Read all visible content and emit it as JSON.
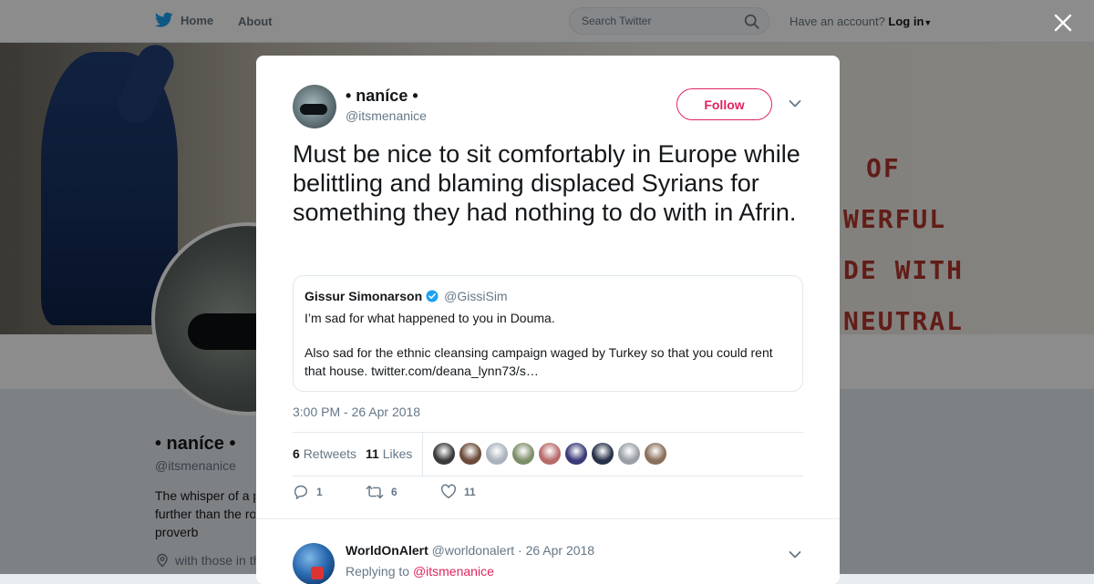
{
  "nav": {
    "home_label": "Home",
    "about_label": "About",
    "search_placeholder": "Search Twitter",
    "have_account_text": "Have an account?",
    "login_label": "Log in"
  },
  "background_profile": {
    "banner_text": [
      "OF",
      "WERFUL",
      "DE WITH",
      "NEUTRAL"
    ],
    "name": "• naníce •",
    "handle": "@itsmenanice",
    "bio": "The whisper of a p further than the ro proverb",
    "bio_lines": [
      "The whisper of a p",
      "further than the ro",
      "proverb"
    ],
    "location": "with those in th"
  },
  "tweet": {
    "author_name": "• naníce •",
    "author_handle": "@itsmenanice",
    "follow_label": "Follow",
    "text": "Must be nice to sit comfortably in Europe while belittling and blaming displaced Syrians for something they had nothing to do with in Afrin.",
    "quoted": {
      "author_name": "Gissur Simonarson",
      "author_handle": "@GissiSim",
      "verified": true,
      "paragraph1": "I’m sad for what happened to you in Douma.",
      "paragraph2": "Also sad for the ethnic cleansing campaign waged by Turkey so that you could rent that house. twitter.com/deana_lynn73/s…"
    },
    "timestamp": "3:00 PM - 26 Apr 2018",
    "retweets_count": "6",
    "retweets_label": "Retweets",
    "likes_count": "11",
    "likes_label": "Likes",
    "liker_avatar_colors": [
      "#3a3a3a",
      "#6b4a3a",
      "#aab2bd",
      "#7d8f6a",
      "#b86a6a",
      "#3b3a78",
      "#27324a",
      "#9aa0a6",
      "#8a6f5a"
    ],
    "actions": {
      "reply_count": "1",
      "retweet_count": "6",
      "like_count": "11"
    }
  },
  "reply": {
    "author_name": "WorldOnAlert",
    "author_handle": "@worldonalert",
    "date": "26 Apr 2018",
    "separator": "·",
    "replying_to_label": "Replying to",
    "replying_to_handle": "@itsmenanice"
  },
  "colors": {
    "accent": "#e0245e",
    "twitter_blue": "#1da1f2",
    "muted": "#657786"
  }
}
